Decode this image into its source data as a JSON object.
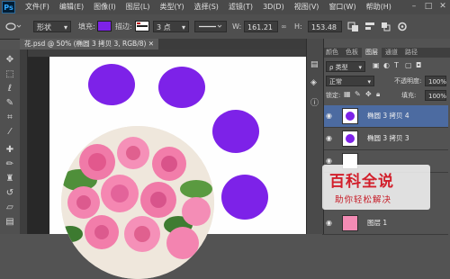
{
  "app": {
    "logo": "Ps"
  },
  "menu": [
    "文件(F)",
    "编辑(E)",
    "图像(I)",
    "图层(L)",
    "类型(Y)",
    "选择(S)",
    "滤镜(T)",
    "3D(D)",
    "视图(V)",
    "窗口(W)",
    "帮助(H)"
  ],
  "window_buttons": [
    "–",
    "□",
    "✕"
  ],
  "options": {
    "shape_mode": "形状",
    "fill_label": "填充:",
    "stroke_label": "描边:",
    "stroke_size": "3 点",
    "w_label": "W:",
    "w_value": "161.21",
    "h_label": "H:",
    "h_value": "153.48"
  },
  "document_tab": "花.psd @ 50% (椭圆 3 拷贝 3, RGB/8) ✕",
  "tools": [
    "move",
    "marquee",
    "lasso",
    "quick-select",
    "crop",
    "eyedropper",
    "brush",
    "stamp",
    "history",
    "eraser",
    "gradient"
  ],
  "panel": {
    "tabs": [
      "颜色",
      "色板",
      "图层",
      "通道",
      "路径"
    ],
    "active_tab": "图层",
    "filter_label": "ρ 类型",
    "blend_mode": "正常",
    "opacity_label": "不透明度:",
    "opacity_value": "100%",
    "lock_label": "锁定:",
    "fill_label": "填充:",
    "fill_value": "100%",
    "layers": [
      {
        "name": "椭圆 3 拷贝 4",
        "selected": true
      },
      {
        "name": "椭圆 3 拷贝 3",
        "selected": false
      },
      {
        "name": "",
        "selected": false
      },
      {
        "name": "图层 1",
        "selected": false
      }
    ]
  },
  "watermark": {
    "title": "百科全说",
    "subtitle": "助你轻松解决"
  },
  "colors": {
    "accent": "#7d22e8",
    "selection": "#4c6ba1"
  }
}
